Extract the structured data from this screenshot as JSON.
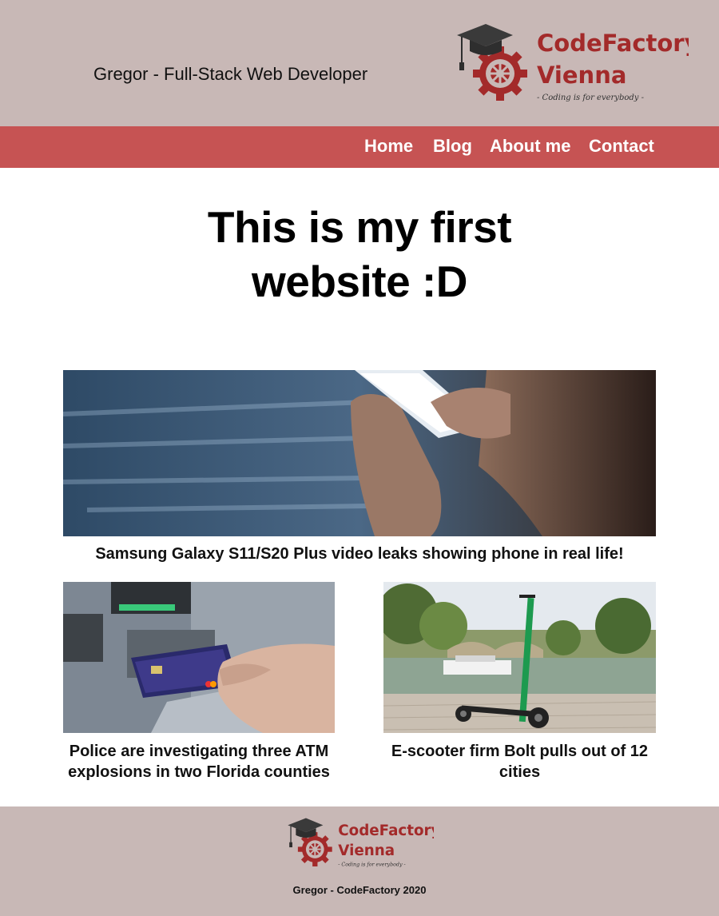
{
  "header": {
    "title": "Gregor - Full-Stack Web Developer",
    "logo": {
      "line1": "CodeFactory",
      "line2": "Vienna",
      "tagline": "- Coding is for everybody -",
      "color": "#a32a2a"
    }
  },
  "nav": {
    "items": [
      {
        "label": "Home"
      },
      {
        "label": "Blog"
      },
      {
        "label": "About me"
      },
      {
        "label": "Contact"
      }
    ],
    "background": "#c65353"
  },
  "main": {
    "heading": "This is my first website :D",
    "articles": [
      {
        "title": "Samsung Galaxy S11/S20 Plus video leaks showing phone in real life!",
        "image": "hands-holding-smartphone-photo"
      },
      {
        "title": "Police are investigating three ATM explosions in two Florida counties",
        "image": "card-inserted-into-atm-photo"
      },
      {
        "title": "E-scooter firm Bolt pulls out of 12 cities",
        "image": "e-scooter-by-river-photo"
      }
    ]
  },
  "footer": {
    "logo": {
      "line1": "CodeFactory",
      "line2": "Vienna",
      "tagline": "- Coding is for everybody -"
    },
    "text": "Gregor - CodeFactory 2020"
  },
  "colors": {
    "header_bg": "#c8b8b6",
    "nav_bg": "#c65353",
    "logo_red": "#a32a2a",
    "footer_bg": "#c8b8b6"
  }
}
